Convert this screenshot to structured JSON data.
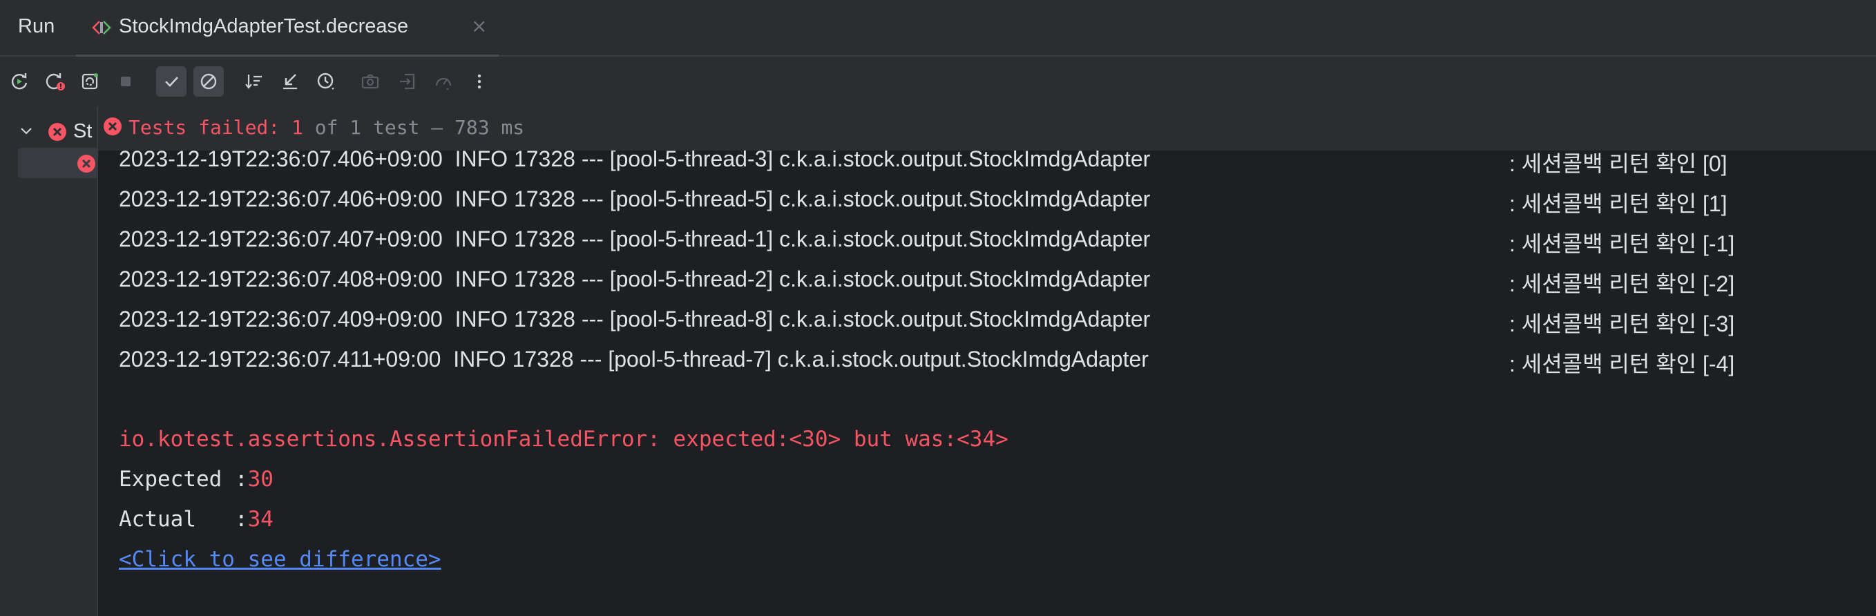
{
  "tabbar": {
    "run_label": "Run",
    "tab_title": "StockImdgAdapterTest.decrease",
    "close_glyph": "×"
  },
  "toolbar": {
    "icons": [
      "rerun-icon",
      "rerun-failed-icon",
      "toggle-auto-test-icon",
      "stop-icon",
      "show-passed-icon",
      "show-ignored-icon",
      "sort-alphabetically-icon",
      "collapse-all-icon",
      "sort-by-duration-icon",
      "camera-icon",
      "import-tests-icon",
      "coverage-icon",
      "more-vertical-icon"
    ]
  },
  "tree": {
    "root_label": "St",
    "status_color": "#f75464"
  },
  "status": {
    "prefix": "Tests failed: ",
    "failed_count": "1",
    "suffix": " of 1 test – 783 ms"
  },
  "console": {
    "log_lines": [
      {
        "head": "2023-12-19T22:36:07.406+09:00  INFO 17328 --- [pool-5-thread-3] c.k.a.i.stock.output.StockImdgAdapter",
        "msg": ": 세션콜백 리턴 확인 [0]"
      },
      {
        "head": "2023-12-19T22:36:07.406+09:00  INFO 17328 --- [pool-5-thread-5] c.k.a.i.stock.output.StockImdgAdapter",
        "msg": ": 세션콜백 리턴 확인 [1]"
      },
      {
        "head": "2023-12-19T22:36:07.407+09:00  INFO 17328 --- [pool-5-thread-1] c.k.a.i.stock.output.StockImdgAdapter",
        "msg": ": 세션콜백 리턴 확인 [-1]"
      },
      {
        "head": "2023-12-19T22:36:07.408+09:00  INFO 17328 --- [pool-5-thread-2] c.k.a.i.stock.output.StockImdgAdapter",
        "msg": ": 세션콜백 리턴 확인 [-2]"
      },
      {
        "head": "2023-12-19T22:36:07.409+09:00  INFO 17328 --- [pool-5-thread-8] c.k.a.i.stock.output.StockImdgAdapter",
        "msg": ": 세션콜백 리턴 확인 [-3]"
      },
      {
        "head": "2023-12-19T22:36:07.411+09:00  INFO 17328 --- [pool-5-thread-7] c.k.a.i.stock.output.StockImdgAdapter",
        "msg": ": 세션콜백 리턴 확인 [-4]"
      }
    ],
    "error": "io.kotest.assertions.AssertionFailedError: expected:<30> but was:<34>",
    "expected_label": "Expected :",
    "expected_value": "30",
    "actual_label": "Actual   :",
    "actual_value": "34",
    "diff_link": "<Click to see difference>"
  },
  "colors": {
    "background": "#1e1f22",
    "panel": "#2b2d30",
    "error": "#f75464",
    "link": "#548af7"
  }
}
